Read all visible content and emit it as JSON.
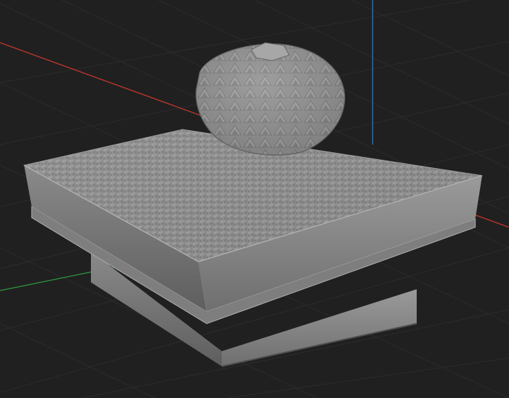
{
  "viewport": {
    "background_color": "#202020",
    "grid_line_color": "#2c2c2c",
    "axis_x_color": "#b5352b",
    "axis_y_color": "#2c8a3e",
    "axis_z_color": "#2f6fa6"
  },
  "model": {
    "surface_color": "#8d8d8d",
    "shadow_color": "#5b5b5b",
    "highlight_color": "#b3b3b3",
    "parts": [
      "cactus-body",
      "gravel-top",
      "upper-pot-block",
      "lower-pot-base"
    ]
  }
}
